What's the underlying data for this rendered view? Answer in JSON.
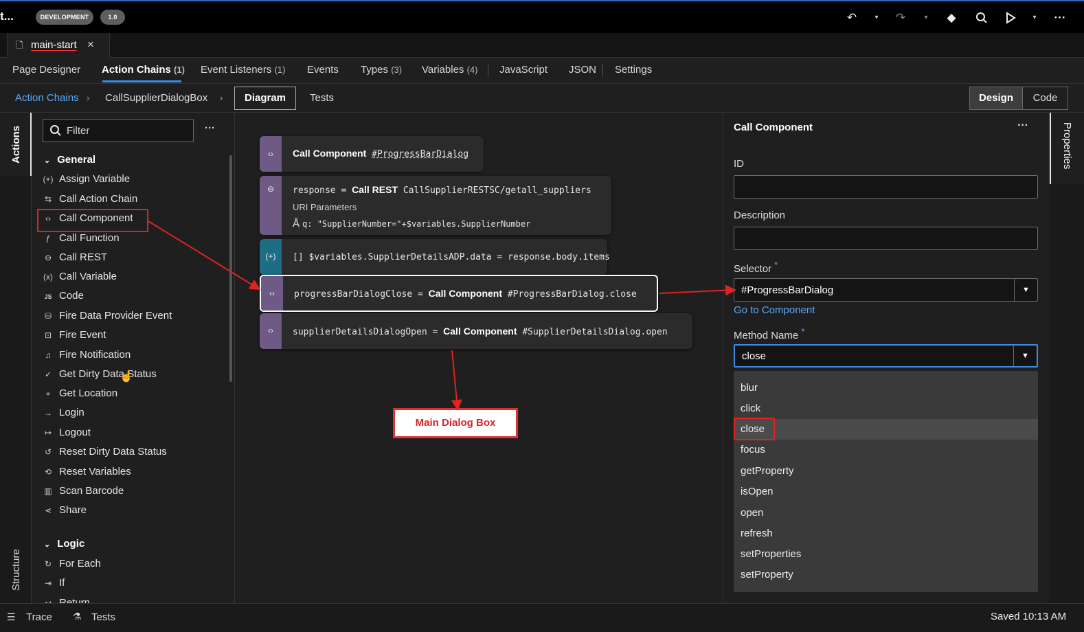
{
  "header": {
    "title": "t...",
    "env_badge": "DEVELOPMENT",
    "version_badge": "1.0",
    "icons": [
      "undo-icon",
      "redo-icon",
      "git-icon",
      "search-icon",
      "run-icon",
      "more-icon"
    ]
  },
  "file_tab": {
    "label": "main-start",
    "close": "×"
  },
  "tabs": [
    {
      "label": "Page Designer",
      "count": ""
    },
    {
      "label": "Action Chains",
      "count": "(1)"
    },
    {
      "label": "Event Listeners",
      "count": "(1)"
    },
    {
      "label": "Events",
      "count": ""
    },
    {
      "label": "Types",
      "count": "(3)"
    },
    {
      "label": "Variables",
      "count": "(4)"
    },
    {
      "label": "JavaScript",
      "count": ""
    },
    {
      "label": "JSON",
      "count": ""
    },
    {
      "label": "Settings",
      "count": ""
    }
  ],
  "breadcrumb": {
    "root": "Action Chains",
    "current": "CallSupplierDialogBox",
    "view_diagram": "Diagram",
    "view_tests": "Tests",
    "mode_design": "Design",
    "mode_code": "Code"
  },
  "left_rail": {
    "top": "Actions",
    "bottom": "Structure"
  },
  "actions_panel": {
    "filter_placeholder": "Filter",
    "more": "···",
    "groups": [
      {
        "name": "General",
        "items": [
          {
            "icon": "(+)",
            "label": "Assign Variable"
          },
          {
            "icon": "⇆",
            "label": "Call Action Chain"
          },
          {
            "icon": "‹›",
            "label": "Call Component"
          },
          {
            "icon": "ƒ",
            "label": "Call Function"
          },
          {
            "icon": "⊖",
            "label": "Call REST"
          },
          {
            "icon": "(x)",
            "label": "Call Variable"
          },
          {
            "icon": "JS",
            "label": "Code"
          },
          {
            "icon": "⛁",
            "label": "Fire Data Provider Event"
          },
          {
            "icon": "⊡",
            "label": "Fire Event"
          },
          {
            "icon": "♫",
            "label": "Fire Notification"
          },
          {
            "icon": "✓",
            "label": "Get Dirty Data Status"
          },
          {
            "icon": "⌖",
            "label": "Get Location"
          },
          {
            "icon": "→",
            "label": "Login"
          },
          {
            "icon": "↦",
            "label": "Logout"
          },
          {
            "icon": "↺",
            "label": "Reset Dirty Data Status"
          },
          {
            "icon": "⟲",
            "label": "Reset Variables"
          },
          {
            "icon": "▥",
            "label": "Scan Barcode"
          },
          {
            "icon": "⋖",
            "label": "Share"
          }
        ]
      },
      {
        "name": "Logic",
        "items": [
          {
            "icon": "↻",
            "label": "For Each"
          },
          {
            "icon": "⇥",
            "label": "If"
          },
          {
            "icon": "↩",
            "label": "Return"
          }
        ]
      }
    ]
  },
  "diagram": {
    "nodes": [
      {
        "kind": "Call Component",
        "arg": "#ProgressBarDialog"
      },
      {
        "lhs": "response",
        "kind": "Call REST",
        "arg": "CallSupplierRESTSC/getall_suppliers",
        "sub_label": "URI Parameters",
        "param": "q: \"SupplierNumber=\"+$variables.SupplierNumber"
      },
      {
        "text": "[] $variables.SupplierDetailsADP.data = response.body.items"
      },
      {
        "lhs": "progressBarDialogClose",
        "kind": "Call Component",
        "arg": "#ProgressBarDialog.close"
      },
      {
        "lhs": "supplierDetailsDialogOpen",
        "kind": "Call Component",
        "arg": "#SupplierDetailsDialog.open"
      }
    ],
    "eq": "=",
    "annotation": "Main Dialog Box"
  },
  "properties": {
    "title": "Call Component",
    "more": "···",
    "id_label": "ID",
    "id_value": "",
    "description_label": "Description",
    "description_value": "",
    "selector_label": "Selector",
    "required_mark": "*",
    "selector_value": "#ProgressBarDialog",
    "go_to_component": "Go to Component",
    "method_label": "Method Name",
    "method_value": "close",
    "method_options": [
      "blur",
      "click",
      "close",
      "focus",
      "getProperty",
      "isOpen",
      "open",
      "refresh",
      "setProperties",
      "setProperty"
    ],
    "highlighted_option": "close"
  },
  "right_rail": {
    "label": "Properties"
  },
  "statusbar": {
    "trace": "Trace",
    "tests": "Tests",
    "saved": "Saved 10:13 AM"
  },
  "colors": {
    "accent": "#3b8beb",
    "annotation_red": "#e02222",
    "node_strip": "#6f5a86",
    "node_strip_teal": "#1d6d85"
  }
}
